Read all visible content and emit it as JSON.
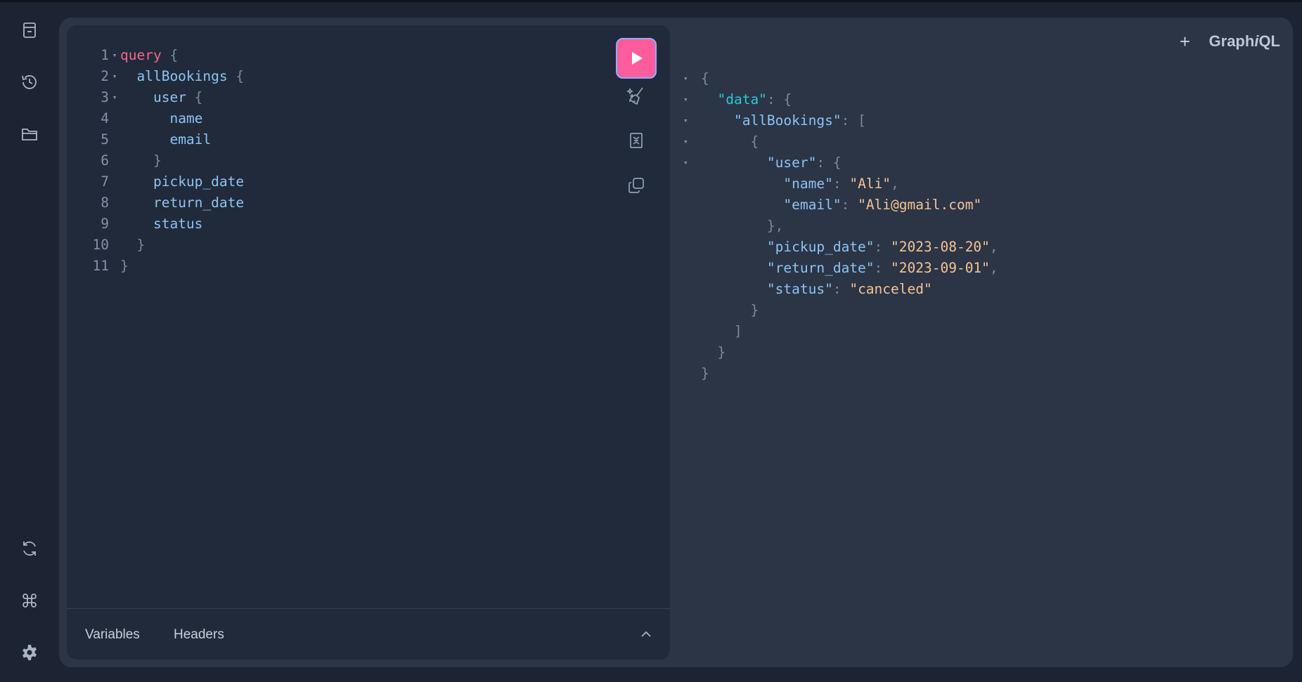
{
  "sidebar": {
    "top_icons": [
      "docs-icon",
      "history-icon",
      "folder-icon"
    ],
    "bottom_icons": [
      "refresh-icon",
      "command-icon",
      "settings-icon"
    ]
  },
  "editor": {
    "lines": [
      {
        "n": "1",
        "fold": true,
        "indent": "",
        "parts": [
          [
            "kw",
            "query"
          ],
          [
            "pn",
            " {"
          ]
        ]
      },
      {
        "n": "2",
        "fold": true,
        "indent": "  ",
        "parts": [
          [
            "fld",
            "allBookings"
          ],
          [
            "pn",
            " {"
          ]
        ]
      },
      {
        "n": "3",
        "fold": true,
        "indent": "    ",
        "parts": [
          [
            "fld",
            "user"
          ],
          [
            "pn",
            " {"
          ]
        ]
      },
      {
        "n": "4",
        "fold": false,
        "indent": "      ",
        "parts": [
          [
            "fld",
            "name"
          ]
        ]
      },
      {
        "n": "5",
        "fold": false,
        "indent": "      ",
        "parts": [
          [
            "fld",
            "email"
          ]
        ]
      },
      {
        "n": "6",
        "fold": false,
        "indent": "    ",
        "parts": [
          [
            "pn",
            "}"
          ]
        ]
      },
      {
        "n": "7",
        "fold": false,
        "indent": "    ",
        "parts": [
          [
            "fld",
            "pickup_date"
          ]
        ]
      },
      {
        "n": "8",
        "fold": false,
        "indent": "    ",
        "parts": [
          [
            "fld",
            "return_date"
          ]
        ]
      },
      {
        "n": "9",
        "fold": false,
        "indent": "    ",
        "parts": [
          [
            "fld",
            "status"
          ]
        ]
      },
      {
        "n": "10",
        "fold": false,
        "indent": "  ",
        "parts": [
          [
            "pn",
            "}"
          ]
        ]
      },
      {
        "n": "11",
        "fold": false,
        "indent": "",
        "parts": [
          [
            "pn",
            "}"
          ]
        ]
      }
    ],
    "tools": [
      "run-icon",
      "prettify-icon",
      "merge-fragments-icon",
      "copy-icon"
    ],
    "tabs": {
      "variables": "Variables",
      "headers": "Headers"
    }
  },
  "header": {
    "plus": "+",
    "logo_prefix": "Graph",
    "logo_i": "i",
    "logo_suffix": "QL"
  },
  "result": {
    "lines": [
      {
        "fold": true,
        "indent": "",
        "parts": [
          [
            "rp",
            "{"
          ]
        ]
      },
      {
        "fold": true,
        "indent": "  ",
        "parts": [
          [
            "key-top",
            "\"data\""
          ],
          [
            "rp",
            ": {"
          ]
        ]
      },
      {
        "fold": true,
        "indent": "    ",
        "parts": [
          [
            "key",
            "\"allBookings\""
          ],
          [
            "rp",
            ": ["
          ]
        ]
      },
      {
        "fold": true,
        "indent": "      ",
        "parts": [
          [
            "rp",
            "{"
          ]
        ]
      },
      {
        "fold": true,
        "indent": "        ",
        "parts": [
          [
            "key",
            "\"user\""
          ],
          [
            "rp",
            ": {"
          ]
        ]
      },
      {
        "fold": false,
        "indent": "          ",
        "parts": [
          [
            "key",
            "\"name\""
          ],
          [
            "rp",
            ": "
          ],
          [
            "str",
            "\"Ali\""
          ],
          [
            "rp",
            ","
          ]
        ]
      },
      {
        "fold": false,
        "indent": "          ",
        "parts": [
          [
            "key",
            "\"email\""
          ],
          [
            "rp",
            ": "
          ],
          [
            "str",
            "\"Ali@gmail.com\""
          ]
        ]
      },
      {
        "fold": false,
        "indent": "        ",
        "parts": [
          [
            "rp",
            "},"
          ]
        ]
      },
      {
        "fold": false,
        "indent": "        ",
        "parts": [
          [
            "key",
            "\"pickup_date\""
          ],
          [
            "rp",
            ": "
          ],
          [
            "str",
            "\"2023-08-20\""
          ],
          [
            "rp",
            ","
          ]
        ]
      },
      {
        "fold": false,
        "indent": "        ",
        "parts": [
          [
            "key",
            "\"return_date\""
          ],
          [
            "rp",
            ": "
          ],
          [
            "str",
            "\"2023-09-01\""
          ],
          [
            "rp",
            ","
          ]
        ]
      },
      {
        "fold": false,
        "indent": "        ",
        "parts": [
          [
            "key",
            "\"status\""
          ],
          [
            "rp",
            ": "
          ],
          [
            "str",
            "\"canceled\""
          ]
        ]
      },
      {
        "fold": false,
        "indent": "      ",
        "parts": [
          [
            "rp",
            "}"
          ]
        ]
      },
      {
        "fold": false,
        "indent": "    ",
        "parts": [
          [
            "rp",
            "]"
          ]
        ]
      },
      {
        "fold": false,
        "indent": "  ",
        "parts": [
          [
            "rp",
            "}"
          ]
        ]
      },
      {
        "fold": false,
        "indent": "",
        "parts": [
          [
            "rp",
            "}"
          ]
        ]
      }
    ]
  },
  "colors": {
    "accent_run": "#ff5c9d",
    "keyword": "#f1678d",
    "field": "#8dc3f4",
    "string": "#f7c393",
    "data_key": "#2cc6d8"
  }
}
